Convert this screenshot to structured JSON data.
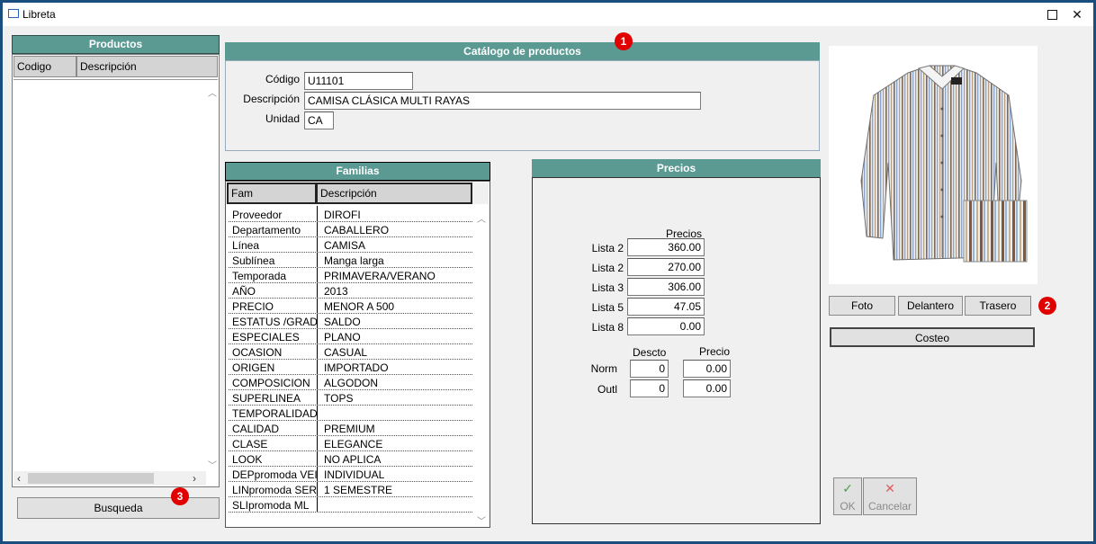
{
  "window": {
    "title": "Libreta"
  },
  "productos": {
    "title": "Productos",
    "columns": [
      "Codigo",
      "Descripción"
    ],
    "search_button": "Busqueda"
  },
  "catalogo": {
    "title": "Catálogo de productos",
    "codigo_label": "Código",
    "codigo_value": "U11101",
    "descripcion_label": "Descripción",
    "descripcion_value": "CAMISA CLÁSICA MULTI RAYAS",
    "unidad_label": "Unidad",
    "unidad_value": "CA"
  },
  "familias": {
    "title": "Familias",
    "columns": [
      "Fam",
      "Descripción"
    ],
    "rows": [
      [
        "Proveedor",
        "DIROFI"
      ],
      [
        "Departamento",
        "CABALLERO"
      ],
      [
        "Línea",
        "CAMISA"
      ],
      [
        "Sublínea",
        "Manga larga"
      ],
      [
        "Temporada",
        "PRIMAVERA/VERANO"
      ],
      [
        "AÑO",
        "2013"
      ],
      [
        "PRECIO",
        "MENOR A 500"
      ],
      [
        "ESTATUS /GRADC",
        "SALDO"
      ],
      [
        "ESPECIALES",
        "PLANO"
      ],
      [
        "OCASION",
        "CASUAL"
      ],
      [
        "ORIGEN",
        "IMPORTADO"
      ],
      [
        "COMPOSICION",
        "ALGODON"
      ],
      [
        "SUPERLINEA",
        "TOPS"
      ],
      [
        "TEMPORALIDAD",
        ""
      ],
      [
        "CALIDAD",
        "PREMIUM"
      ],
      [
        "CLASE",
        "ELEGANCE"
      ],
      [
        "LOOK",
        "NO APLICA"
      ],
      [
        "DEPpromoda VEI",
        "INDIVIDUAL"
      ],
      [
        "LINpromoda SER",
        "1 SEMESTRE"
      ],
      [
        "SLIpromoda ML",
        ""
      ]
    ]
  },
  "precios": {
    "title": "Precios",
    "col_header": "Precios",
    "listas": [
      {
        "label": "Lista 2",
        "value": "360.00"
      },
      {
        "label": "Lista 2",
        "value": "270.00"
      },
      {
        "label": "Lista 3",
        "value": "306.00"
      },
      {
        "label": "Lista 5",
        "value": "47.05"
      },
      {
        "label": "Lista 8",
        "value": "0.00"
      }
    ],
    "descto_header": "Descto",
    "precio_header": "Precio",
    "norm_label": "Norm",
    "norm_descto": "0",
    "norm_precio": "0.00",
    "outl_label": "Outl",
    "outl_descto": "0",
    "outl_precio": "0.00"
  },
  "image_buttons": {
    "foto": "Foto",
    "delantero": "Delantero",
    "trasero": "Trasero",
    "costeo": "Costeo"
  },
  "dialog_buttons": {
    "ok": "OK",
    "cancelar": "Cancelar"
  },
  "badges": {
    "b1": "1",
    "b2": "2",
    "b3": "3"
  },
  "colors": {
    "header_teal": "#5b9a93",
    "badge_red": "#e00000",
    "window_border": "#1a4e7e"
  }
}
